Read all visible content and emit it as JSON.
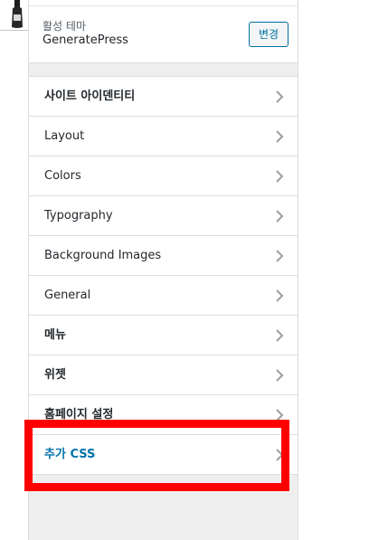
{
  "theme_panel": {
    "label": "활성 테마",
    "theme_name": "GeneratePress",
    "change_label": "변경"
  },
  "sections": [
    {
      "label": "사이트 아이덴티티",
      "icon": "chevron-right-icon"
    },
    {
      "label": "Layout",
      "icon": "chevron-right-icon"
    },
    {
      "label": "Colors",
      "icon": "chevron-right-icon"
    },
    {
      "label": "Typography",
      "icon": "chevron-right-icon"
    },
    {
      "label": "Background Images",
      "icon": "chevron-right-icon"
    },
    {
      "label": "General",
      "icon": "chevron-right-icon"
    },
    {
      "label": "메뉴",
      "icon": "chevron-right-icon"
    },
    {
      "label": "위젯",
      "icon": "chevron-right-icon"
    },
    {
      "label": "홈페이지 설정",
      "icon": "chevron-right-icon"
    },
    {
      "label": "추가 CSS",
      "icon": "chevron-right-icon",
      "highlighted": true
    }
  ],
  "colors": {
    "accent": "#0071a1",
    "highlight": "#ff0000",
    "panel_background": "#eeeeee"
  }
}
